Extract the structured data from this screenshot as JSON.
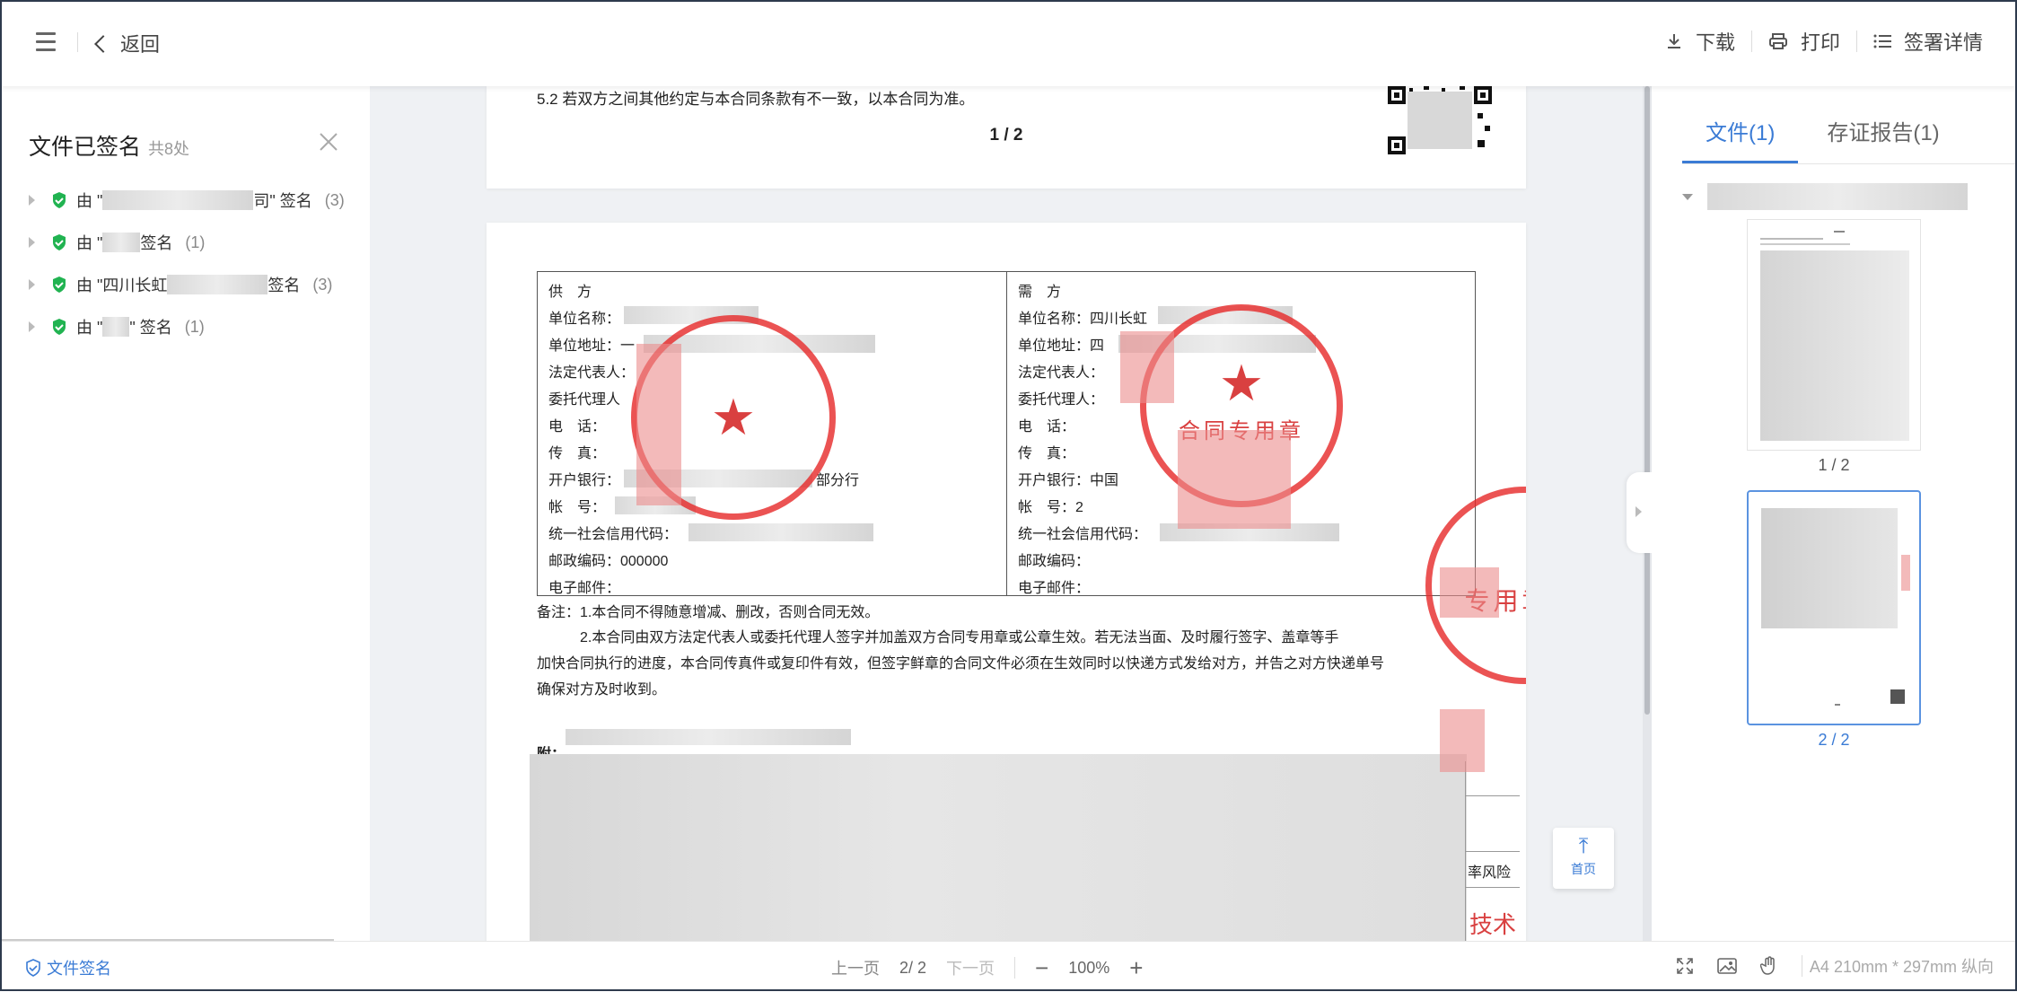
{
  "topbar": {
    "back_label": "返回",
    "download_label": "下载",
    "print_label": "打印",
    "sign_details_label": "签署详情"
  },
  "left_panel": {
    "title": "文件已签名",
    "total": "共8处",
    "signers": [
      {
        "prefix": "由 \"",
        "visible_part": "",
        "suffix": "司\" 签名",
        "count": "(3)"
      },
      {
        "prefix": "由 \"",
        "visible_part": "",
        "suffix": " 签名",
        "count": "(1)"
      },
      {
        "prefix": "由 \"",
        "visible_part": "四川长虹",
        "suffix": " 签名",
        "count": "(3)"
      },
      {
        "prefix": "由 \"",
        "visible_part": "",
        "suffix": "\" 签名",
        "count": "(1)"
      }
    ]
  },
  "document": {
    "page1": {
      "clause": "5.2 若双方之间其他约定与本合同条款有不一致，以本合同为准。",
      "page_number": "1 / 2"
    },
    "supplier": {
      "heading": "供　方",
      "rows": [
        "单位名称：",
        "单位地址：一",
        "法定代表人：",
        "委托代理人",
        "电　话：",
        "传　真：",
        "开户银行：",
        "帐　号：",
        "统一社会信用代码：",
        "邮政编码：000000",
        "电子邮件："
      ],
      "bank_suffix": "部分行"
    },
    "buyer": {
      "heading": "需　方",
      "rows": [
        "单位名称：四川长虹",
        "单位地址：四",
        "法定代表人：",
        "委托代理人：",
        "电　话：",
        "传　真：",
        "开户银行：中国",
        "帐　号：2",
        "统一社会信用代码：",
        "邮政编码：",
        "电子邮件："
      ]
    },
    "notes": [
      "备注：1.本合同不得随意增减、删改，否则合同无效。",
      "　　　2.本合同由双方法定代表人或委托代理人签字并加盖双方合同专用章或公章生效。若无法当面、及时履行签字、盖章等手",
      "加快合同执行的进度，本合同传真件或复印件有效，但签字鲜章的合同文件必须在生效同时以快递方式发给对方，并告之对方快递单号",
      "确保对方及时收到。"
    ],
    "attachment_label": "附：",
    "stamp_text_right": "合同专用章",
    "stamp_text_bottom": "专用章",
    "risk_label": "率风险",
    "tech_label": "技术"
  },
  "top_button_label": "首页",
  "right_panel": {
    "tabs": [
      "文件(1)",
      "存证报告(1)"
    ],
    "active_tab": 0,
    "thumbnails": [
      {
        "label": "1 / 2",
        "selected": false
      },
      {
        "label": "2 / 2",
        "selected": true
      }
    ]
  },
  "bottombar": {
    "file_sign_label": "文件签名",
    "prev_label": "上一页",
    "page_indicator": "2/ 2",
    "next_label": "下一页",
    "zoom_out": "−",
    "zoom_level": "100%",
    "zoom_in": "+",
    "paper_info": "A4 210mm * 297mm 纵向"
  },
  "colors": {
    "accent": "#3a7bd5",
    "check_green": "#21b351",
    "stamp_red": "#e32828"
  },
  "icons": [
    "menu-icon",
    "chevron-left-icon",
    "download-icon",
    "printer-icon",
    "list-icon",
    "close-icon",
    "shield-check-icon",
    "arrow-up-icon",
    "fullscreen-icon",
    "image-icon",
    "hand-icon"
  ]
}
